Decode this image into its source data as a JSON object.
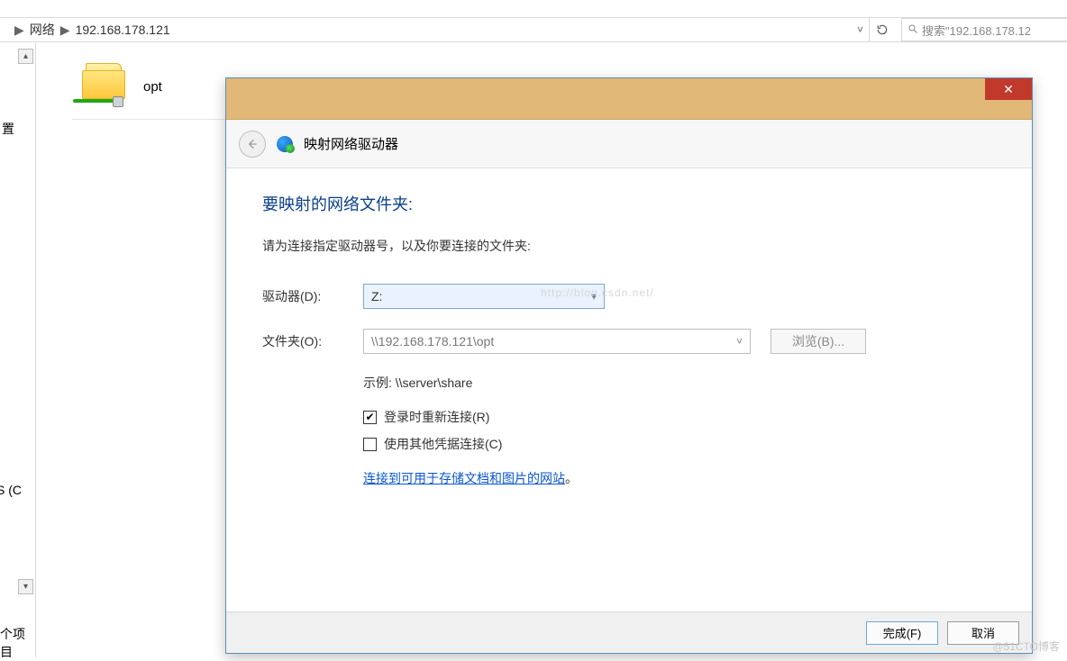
{
  "explorer": {
    "breadcrumb_root": "网络",
    "breadcrumb_loc": "192.168.178.121",
    "search_placeholder": "搜索\"192.168.178.12",
    "folder_name": "opt",
    "sidebar_partial_1": "置",
    "sidebar_partial_2": "S (C",
    "sidebar_partial_3": "个项目"
  },
  "dialog": {
    "title": "映射网络驱动器",
    "heading": "要映射的网络文件夹:",
    "description": "请为连接指定驱动器号，以及你要连接的文件夹:",
    "drive_label": "驱动器(D):",
    "drive_value": "Z:",
    "folder_label": "文件夹(O):",
    "folder_value": "\\\\192.168.178.121\\opt",
    "browse": "浏览(B)...",
    "example": "示例: \\\\server\\share",
    "chk_reconnect": "登录时重新连接(R)",
    "chk_othercred": "使用其他凭据连接(C)",
    "link_text": "连接到可用于存储文档和图片的网站",
    "period": "。",
    "ok": "完成(F)",
    "cancel": "取消"
  },
  "watermark": "@51CTO博客",
  "ghost": "http://blog.csdn.net/"
}
